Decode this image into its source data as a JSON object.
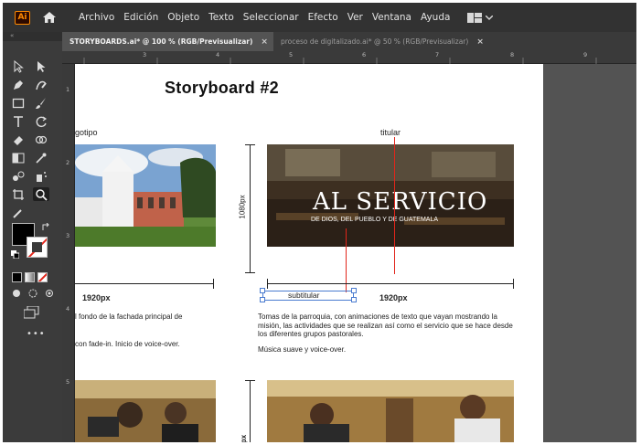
{
  "app": {
    "logo": "Ai",
    "menus": [
      "Archivo",
      "Edición",
      "Objeto",
      "Texto",
      "Seleccionar",
      "Efecto",
      "Ver",
      "Ventana",
      "Ayuda"
    ]
  },
  "tabs": [
    {
      "label": "STORYBOARDS.ai* @ 100 % (RGB/Previsualizar)",
      "active": true
    },
    {
      "label": "proceso de digitalizado.ai* @ 50 % (RGB/Previsualizar)",
      "active": false
    }
  ],
  "toolbar_icons": [
    "selection-tool-icon",
    "direct-selection-tool-icon",
    "pen-tool-icon",
    "curvature-tool-icon",
    "rectangle-tool-icon",
    "paintbrush-tool-icon",
    "type-tool-icon",
    "rotate-tool-icon",
    "eraser-tool-icon",
    "shape-builder-tool-icon",
    "gradient-tool-icon",
    "eyedropper-tool-icon",
    "blend-tool-icon",
    "symbol-sprayer-tool-icon",
    "artboard-tool-icon",
    "zoom-tool-icon",
    "color-picker-icon"
  ],
  "ruler": {
    "h_marks": [
      "3",
      "4",
      "5",
      "6",
      "7",
      "8",
      "9"
    ],
    "v_marks": [
      "1",
      "2",
      "3",
      "4",
      "5"
    ]
  },
  "artboard": {
    "title": "Storyboard #2",
    "label_logo": "gotipo",
    "label_titular": "titular",
    "label_1080": "1080px",
    "label_1920_left": "1920px",
    "label_1920_right": "1920px",
    "label_subtitular": "subtitular",
    "label_px_bottom": "px",
    "overlay_title": "AL SERVICIO",
    "overlay_subtitle": "DE DIOS, DEL PUEBLO Y DE GUATEMALA",
    "left_desc_1": "l fondo de la fachada principal de",
    "left_desc_2": "con fade-in. Inicio de voice-over.",
    "right_desc": "Tomas de la parroquia, con animaciones de texto que vayan mostrando la misión, las actividades que se realizan así como el servicio que se hace desde los diferentes grupos pastorales.",
    "right_music": "Música suave y voice-over."
  },
  "colors": {
    "accent_red": "#e1251b",
    "selection_blue": "#4a7bd0",
    "ui_dark": "#323232",
    "ui_mid": "#535353"
  }
}
